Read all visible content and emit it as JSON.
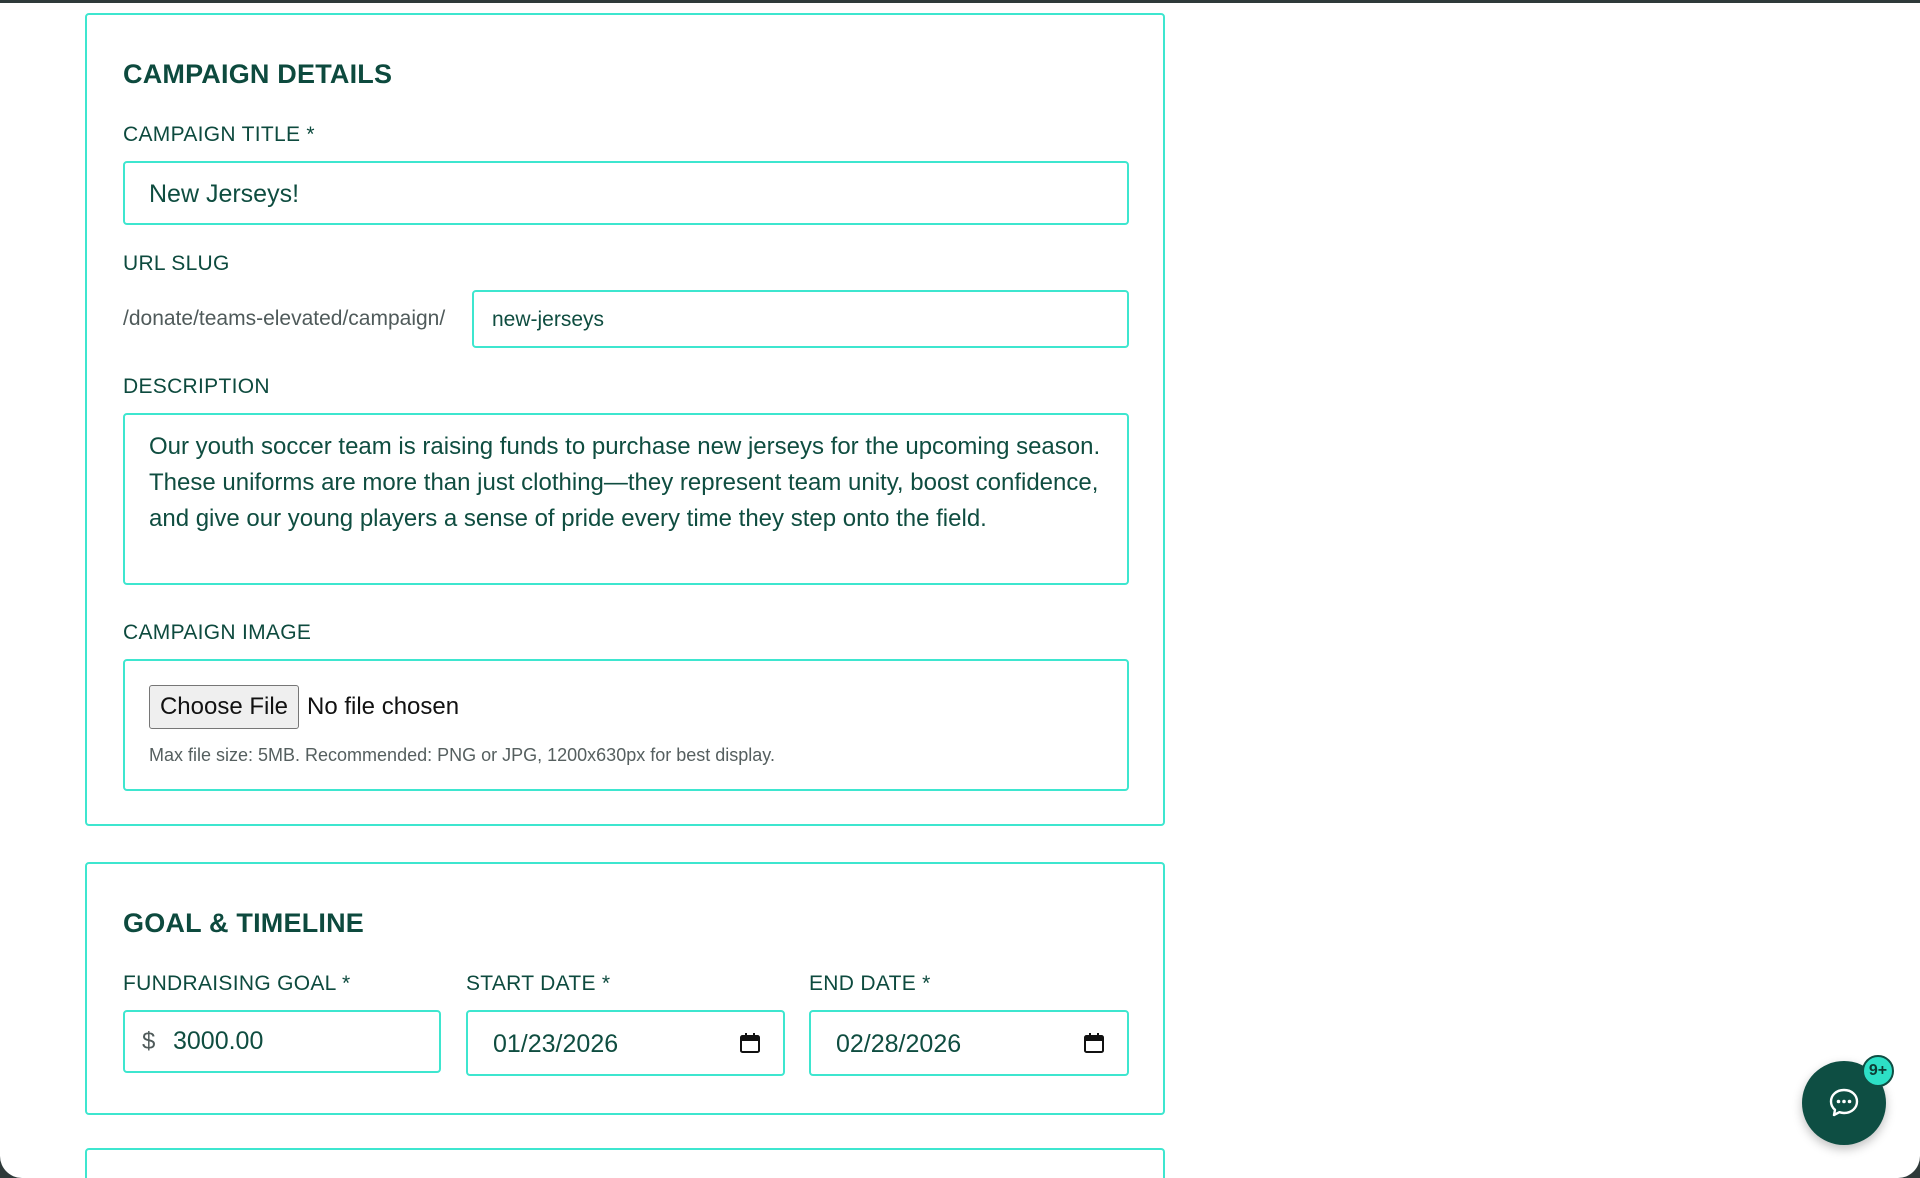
{
  "details": {
    "title": "CAMPAIGN DETAILS",
    "campaign_title_label": "CAMPAIGN TITLE *",
    "campaign_title_value": "New Jerseys!",
    "slug_label": "URL SLUG",
    "slug_prefix": "/donate/teams-elevated/campaign/",
    "slug_value": "new-jerseys",
    "description_label": "DESCRIPTION",
    "description_value": "Our youth soccer team is raising funds to purchase new jerseys for the upcoming season. These uniforms are more than just clothing—they represent team unity, boost confidence, and give our young players a sense of pride every time they step onto the field.",
    "image_label": "CAMPAIGN IMAGE",
    "choose_file_label": "Choose File",
    "no_file_text": "No file chosen",
    "file_hint": "Max file size: 5MB. Recommended: PNG or JPG, 1200x630px for best display."
  },
  "goal": {
    "title": "GOAL & TIMELINE",
    "goal_label": "FUNDRAISING GOAL *",
    "currency_symbol": "$",
    "goal_value": "3000.00",
    "start_label": "START DATE *",
    "start_value": "01/23/2026",
    "end_label": "END DATE *",
    "end_value": "02/28/2026"
  },
  "chat": {
    "badge": "9+",
    "icon": "chat-bubble-icon"
  },
  "colors": {
    "accent": "#3ee6cf",
    "text": "#0d4a3e",
    "chat_bg": "#0e4e43",
    "badge_bg": "#2de0c6"
  }
}
